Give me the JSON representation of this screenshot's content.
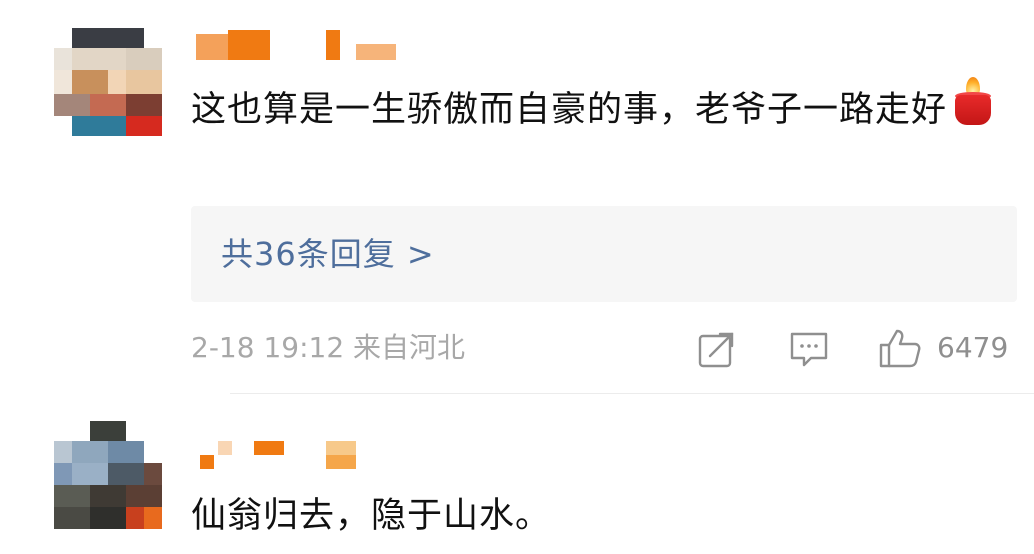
{
  "comments": [
    {
      "text": "这也算是一生骄傲而自豪的事，老爷子一路走好",
      "emoji": "candle-icon",
      "replies_label": "共36条回复 >",
      "time": "2-18 19:12 来自河北",
      "likes": "6479"
    },
    {
      "text": "仙翁归去，隐于山水。"
    }
  ],
  "colors": {
    "reply_link": "#4e6e9c",
    "meta_text": "#a8a8a8",
    "reply_bg": "#f6f6f6",
    "username_orange": "#f07a12"
  }
}
